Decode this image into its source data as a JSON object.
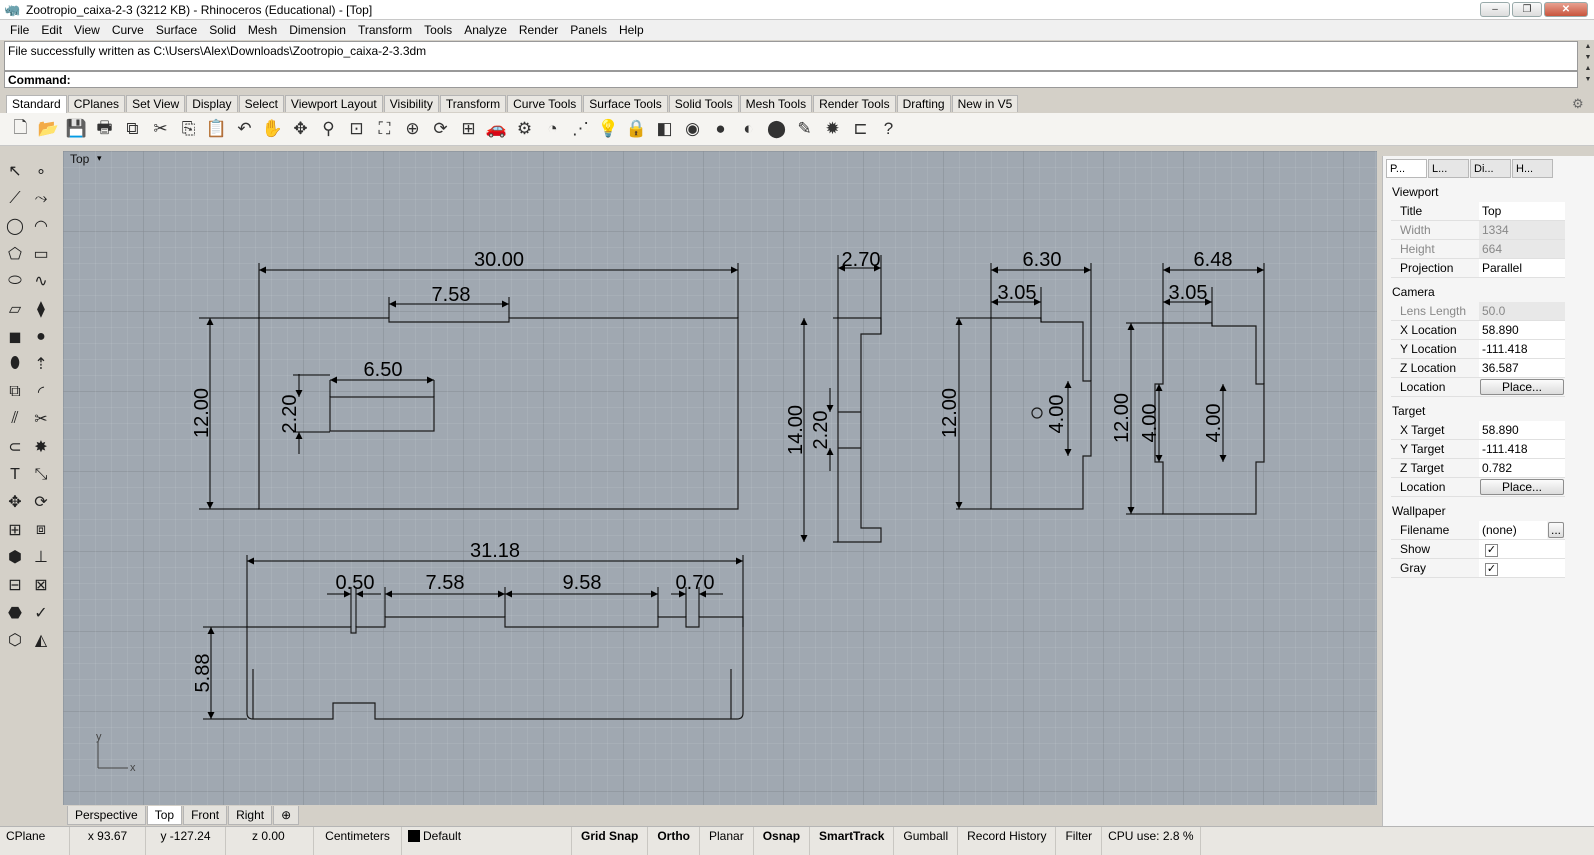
{
  "window": {
    "title": "Zootropio_caixa-2-3 (3212 KB) - Rhinoceros (Educational) - [Top]",
    "min": "–",
    "max": "❐",
    "close": "✕"
  },
  "menu": [
    "File",
    "Edit",
    "View",
    "Curve",
    "Surface",
    "Solid",
    "Mesh",
    "Dimension",
    "Transform",
    "Tools",
    "Analyze",
    "Render",
    "Panels",
    "Help"
  ],
  "command": {
    "history": "File successfully written as C:\\Users\\Alex\\Downloads\\Zootropio_caixa-2-3.3dm",
    "prompt": "Command:"
  },
  "toolbar_tabs": [
    "Standard",
    "CPlanes",
    "Set View",
    "Display",
    "Select",
    "Viewport Layout",
    "Visibility",
    "Transform",
    "Curve Tools",
    "Surface Tools",
    "Solid Tools",
    "Mesh Tools",
    "Render Tools",
    "Drafting",
    "New in V5"
  ],
  "toolbar_tools": [
    "new-icon",
    "open-icon",
    "save-icon",
    "print-icon",
    "import-icon",
    "cut-icon",
    "copy-icon",
    "paste-icon",
    "undo-icon",
    "pan-icon",
    "move-view-icon",
    "zoom-icon",
    "zoom-window-icon",
    "zoom-extents-icon",
    "zoom-selected-icon",
    "rotate-view-icon",
    "four-viewports-icon",
    "car-icon",
    "options-icon",
    "circle-icon",
    "points-icon",
    "light-icon",
    "lock-icon",
    "layer-icon",
    "color-wheel-icon",
    "render-sphere-icon",
    "shaded-sphere-icon",
    "blue-sphere-icon",
    "pencil-icon",
    "gear-icon",
    "dimension-icon",
    "help-icon"
  ],
  "toolbar_glyphs": [
    "🗋",
    "📂",
    "💾",
    "🖶",
    "⧉",
    "✂",
    "⎘",
    "📋",
    "↶",
    "✋",
    "✥",
    "⚲",
    "⊡",
    "⛶",
    "⊕",
    "⟳",
    "⊞",
    "🚗",
    "⚙",
    "◔",
    "⋰",
    "💡",
    "🔒",
    "◧",
    "◉",
    "●",
    "◐",
    "⬤",
    "✎",
    "✹",
    "⊏",
    "?"
  ],
  "viewport": {
    "label": "Top",
    "dropdown": "▾",
    "axis_x": "x",
    "axis_y": "y"
  },
  "dims": {
    "top_width": "30.00",
    "top_slot": "7.58",
    "top_height": "12.00",
    "inner_width": "6.50",
    "inner_height": "2.20",
    "side1_width": "2.70",
    "side1_height": "14.00",
    "side1_tab": "2.20",
    "side2_width": "6.30",
    "side2_notch": "3.05",
    "side2_height": "12.00",
    "side2_tab": "4.00",
    "side3_width": "6.48",
    "side3_notch": "3.05",
    "side3_height": "12.00",
    "side3_tab_l": "4.00",
    "side3_tab_r": "4.00",
    "bottom_width": "31.18",
    "bottom_a": "0.50",
    "bottom_b": "7.58",
    "bottom_c": "9.58",
    "bottom_d": "0.70",
    "bottom_height": "5.88"
  },
  "viewport_tabs": [
    "Perspective",
    "Top",
    "Front",
    "Right",
    "⊕"
  ],
  "panel": {
    "tabs": [
      "P...",
      "L...",
      "Di...",
      "H..."
    ],
    "sections": {
      "viewport": "Viewport",
      "camera": "Camera",
      "target": "Target",
      "wallpaper": "Wallpaper"
    },
    "viewport_rows": [
      {
        "key": "Title",
        "value": "Top"
      },
      {
        "key": "Width",
        "value": "1334"
      },
      {
        "key": "Height",
        "value": "664"
      },
      {
        "key": "Projection",
        "value": "Parallel"
      }
    ],
    "camera_rows": [
      {
        "key": "Lens Length",
        "value": "50.0"
      },
      {
        "key": "X Location",
        "value": "58.890"
      },
      {
        "key": "Y Location",
        "value": "-111.418"
      },
      {
        "key": "Z Location",
        "value": "36.587"
      },
      {
        "key": "Location",
        "value": "Place..."
      }
    ],
    "target_rows": [
      {
        "key": "X Target",
        "value": "58.890"
      },
      {
        "key": "Y Target",
        "value": "-111.418"
      },
      {
        "key": "Z Target",
        "value": "0.782"
      },
      {
        "key": "Location",
        "value": "Place..."
      }
    ],
    "wallpaper_rows": [
      {
        "key": "Filename",
        "value": "(none)"
      },
      {
        "key": "Show",
        "value": "✓"
      },
      {
        "key": "Gray",
        "value": "✓"
      }
    ],
    "browse": "..."
  },
  "status": {
    "cplane": "CPlane",
    "x": "x 93.67",
    "y": "y -127.24",
    "z": "z 0.00",
    "units": "Centimeters",
    "layer": "Default",
    "toggles": [
      {
        "label": "Grid Snap",
        "on": true
      },
      {
        "label": "Ortho",
        "on": true
      },
      {
        "label": "Planar",
        "on": false
      },
      {
        "label": "Osnap",
        "on": true
      },
      {
        "label": "SmartTrack",
        "on": true
      },
      {
        "label": "Gumball",
        "on": false
      },
      {
        "label": "Record History",
        "on": false
      },
      {
        "label": "Filter",
        "on": false
      }
    ],
    "cpu": "CPU use: 2.8 %"
  }
}
